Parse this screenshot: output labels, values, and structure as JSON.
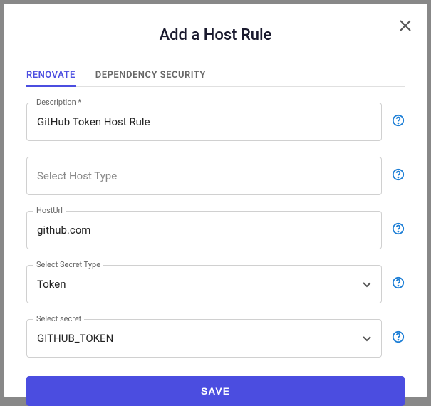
{
  "modal": {
    "title": "Add a Host Rule"
  },
  "tabs": [
    {
      "label": "RENOVATE",
      "active": true
    },
    {
      "label": "DEPENDENCY SECURITY",
      "active": false
    }
  ],
  "fields": {
    "description": {
      "label": "Description *",
      "value": "GitHub Token Host Rule"
    },
    "hostType": {
      "placeholder": "Select Host Type",
      "value": ""
    },
    "hostUrl": {
      "label": "HostUrl",
      "value": "github.com"
    },
    "secretType": {
      "label": "Select Secret Type",
      "value": "Token"
    },
    "secret": {
      "label": "Select secret",
      "value": "GITHUB_TOKEN"
    }
  },
  "actions": {
    "save": "SAVE"
  }
}
